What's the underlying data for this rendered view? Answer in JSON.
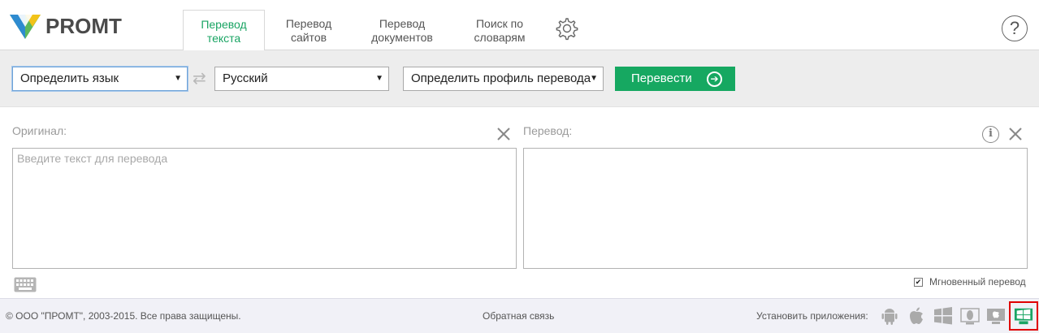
{
  "brand": {
    "name": "PROMT"
  },
  "tabs": [
    {
      "line1": "Перевод",
      "line2": "текста",
      "active": true
    },
    {
      "line1": "Перевод",
      "line2": "сайтов",
      "active": false
    },
    {
      "line1": "Перевод",
      "line2": "документов",
      "active": false
    },
    {
      "line1": "Поиск по",
      "line2": "словарям",
      "active": false
    }
  ],
  "header": {
    "settings_icon": "gear-icon",
    "help_label": "?"
  },
  "toolbar": {
    "source_language": "Определить язык",
    "target_language": "Русский",
    "profile": "Определить профиль перевода",
    "swap_icon": "swap-arrows-icon",
    "translate_label": "Перевести",
    "translate_icon": "arrow-right-circle-icon"
  },
  "panels": {
    "original_label": "Оригинал:",
    "original_placeholder": "Введите текст для перевода",
    "translation_label": "Перевод:",
    "instant_translation_label": "Мгновенный перевод",
    "instant_translation_checked": true
  },
  "footer": {
    "copyright": "© ООО \"ПРОМТ\", 2003-2015. Все права защищены.",
    "feedback": "Обратная связь",
    "install_label": "Установить приложения:",
    "apps": [
      "android-icon",
      "apple-icon",
      "windows-icon",
      "linux-icon",
      "mac-icon",
      "windows-store-icon"
    ]
  },
  "colors": {
    "accent": "#16a861",
    "tab_active_text": "#19a463",
    "highlight_border": "#e00000"
  }
}
